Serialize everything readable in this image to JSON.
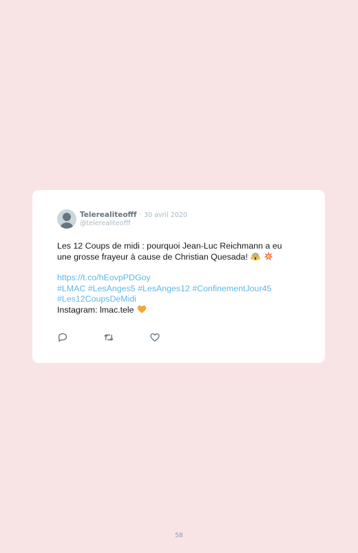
{
  "tweet": {
    "author_name": "Telerealiteofff",
    "separator": "·",
    "date": "30 avril 2020",
    "handle": "@telerealiteofff",
    "text_line1": "Les 12 Coups de midi : pourquoi Jean-Luc Reichmann a eu",
    "text_line2": "une grosse frayeur à cause de Christian Quesada!",
    "link": "https://t.co/hEovpPDGoy",
    "hashtags_line1": "#LMAC #LesAnges5 #LesAnges12 #ConfinementJour45",
    "hashtags_line2": "#Les12CoupsDeMidi",
    "instagram": "Instagram: lmac.tele",
    "emojis": [
      "screaming-face-emoji",
      "collision-emoji",
      "orange-heart-emoji"
    ],
    "actions": [
      "reply-icon",
      "retweet-icon",
      "like-icon"
    ]
  },
  "page": {
    "number": "58"
  },
  "colors": {
    "background": "#f9e4e5",
    "card": "#ffffff",
    "link": "#5fb8e6",
    "muted": "#aab8c2",
    "heart": "#f4a636"
  }
}
